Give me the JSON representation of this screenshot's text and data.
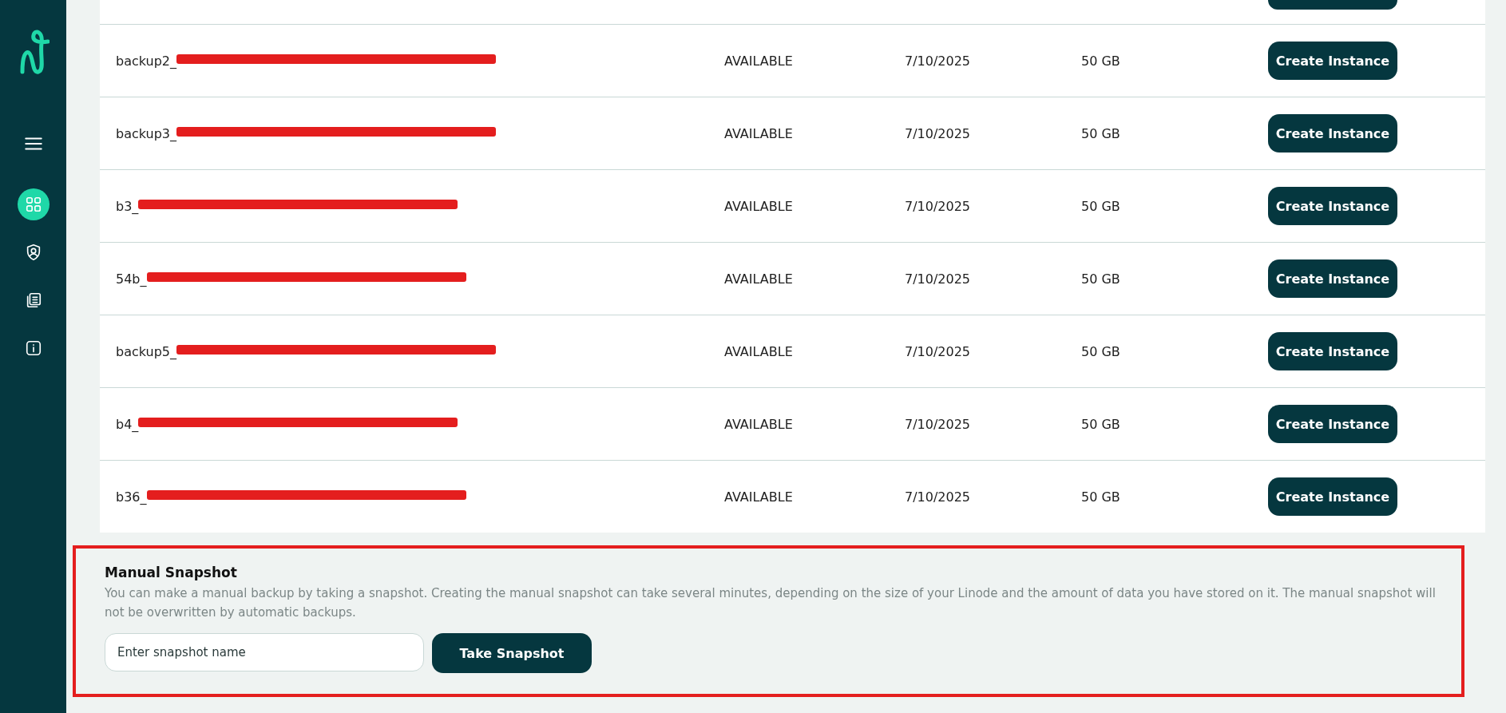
{
  "sidebar": {
    "items": [
      {
        "kind": "menu",
        "selected": false
      },
      {
        "kind": "grid",
        "selected": true
      },
      {
        "kind": "shield",
        "selected": false
      },
      {
        "kind": "documents",
        "selected": false
      },
      {
        "kind": "info",
        "selected": false
      }
    ]
  },
  "backups": {
    "rows": [
      {
        "name": "backup2_",
        "redacted": true,
        "status": "AVAILABLE",
        "date": "7/10/2025",
        "size": "50 GB",
        "action": "Create Instance"
      },
      {
        "name": "backup3_",
        "redacted": true,
        "status": "AVAILABLE",
        "date": "7/10/2025",
        "size": "50 GB",
        "action": "Create Instance"
      },
      {
        "name": "b3_",
        "redacted": true,
        "status": "AVAILABLE",
        "date": "7/10/2025",
        "size": "50 GB",
        "action": "Create Instance"
      },
      {
        "name": "54b_",
        "redacted": true,
        "status": "AVAILABLE",
        "date": "7/10/2025",
        "size": "50 GB",
        "action": "Create Instance"
      },
      {
        "name": "backup5_",
        "redacted": true,
        "status": "AVAILABLE",
        "date": "7/10/2025",
        "size": "50 GB",
        "action": "Create Instance"
      },
      {
        "name": "b4_",
        "redacted": true,
        "status": "AVAILABLE",
        "date": "7/10/2025",
        "size": "50 GB",
        "action": "Create Instance"
      },
      {
        "name": "b36_",
        "redacted": true,
        "status": "AVAILABLE",
        "date": "7/10/2025",
        "size": "50 GB",
        "action": "Create Instance"
      }
    ]
  },
  "manual_snapshot": {
    "title": "Manual Snapshot",
    "highlighted": true,
    "description": "You can make a manual backup by taking a snapshot. Creating the manual snapshot can take several minutes, depending on the size of your Linode and the amount of data you have stored on it. The manual snapshot will not be overwritten by automatic backups.",
    "placeholder": "Enter snapshot name",
    "button": "Take Snapshot"
  }
}
